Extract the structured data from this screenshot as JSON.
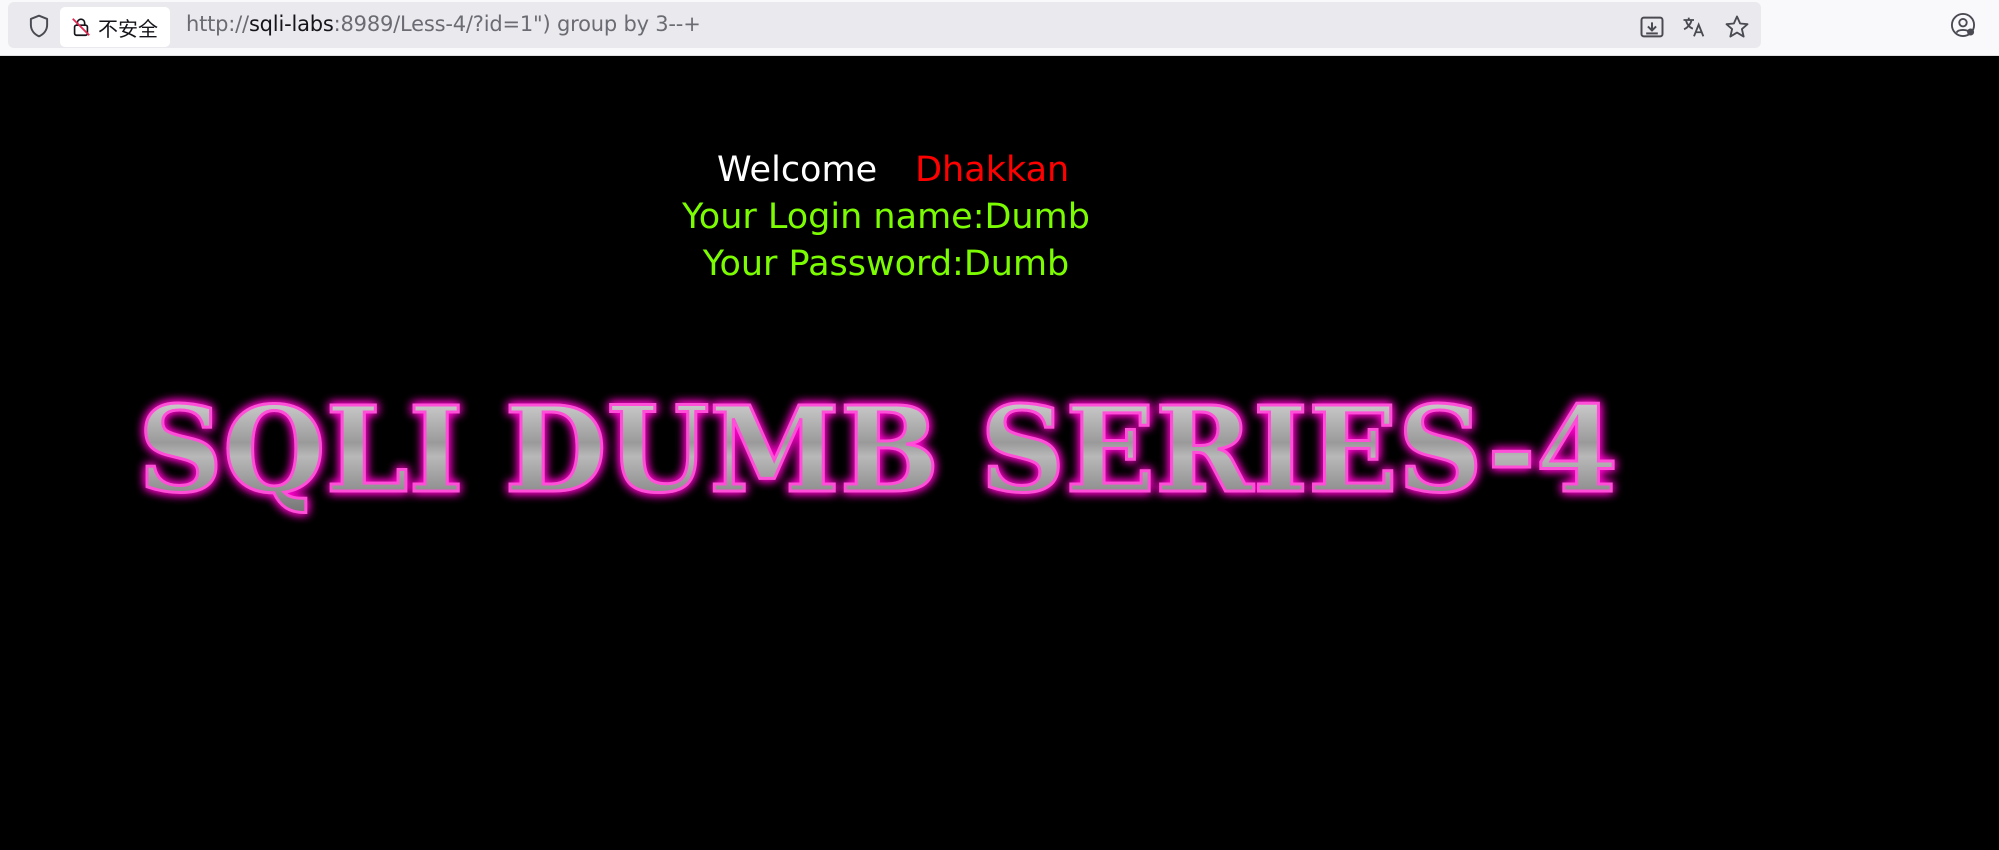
{
  "browser": {
    "security_label": "不安全",
    "url_scheme": "http://",
    "url_host": "sqli-labs",
    "url_rest": ":8989/Less-4/?id=1\") group by 3--+",
    "icons": [
      "shield-icon",
      "lock-crossed-icon",
      "download-icon",
      "translate-icon",
      "star-icon",
      "account-icon"
    ]
  },
  "page": {
    "welcome_word": "Welcome",
    "welcome_name": "Dhakkan",
    "login_line": "Your Login name:Dumb",
    "password_line": "Your Password:Dumb",
    "banner_text": "SQLI DUMB SERIES-4"
  },
  "colors": {
    "background": "#000000",
    "welcome": "#ffffff",
    "name": "#ff0000",
    "credentials": "#7cfc00",
    "banner_glow": "#ff00cc"
  }
}
